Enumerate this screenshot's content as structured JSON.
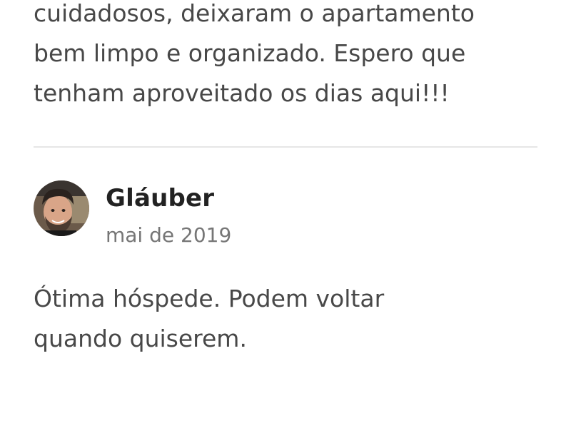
{
  "previous_review": {
    "text": "cuidadosos, deixaram o apartamento\nbem limpo e organizado. Espero que\ntenham aproveitado os dias aqui!!!"
  },
  "review": {
    "reviewer_name": "Gláuber",
    "date": "mai de 2019",
    "text": "Ótima hóspede. Podem voltar\nquando quiserem."
  }
}
